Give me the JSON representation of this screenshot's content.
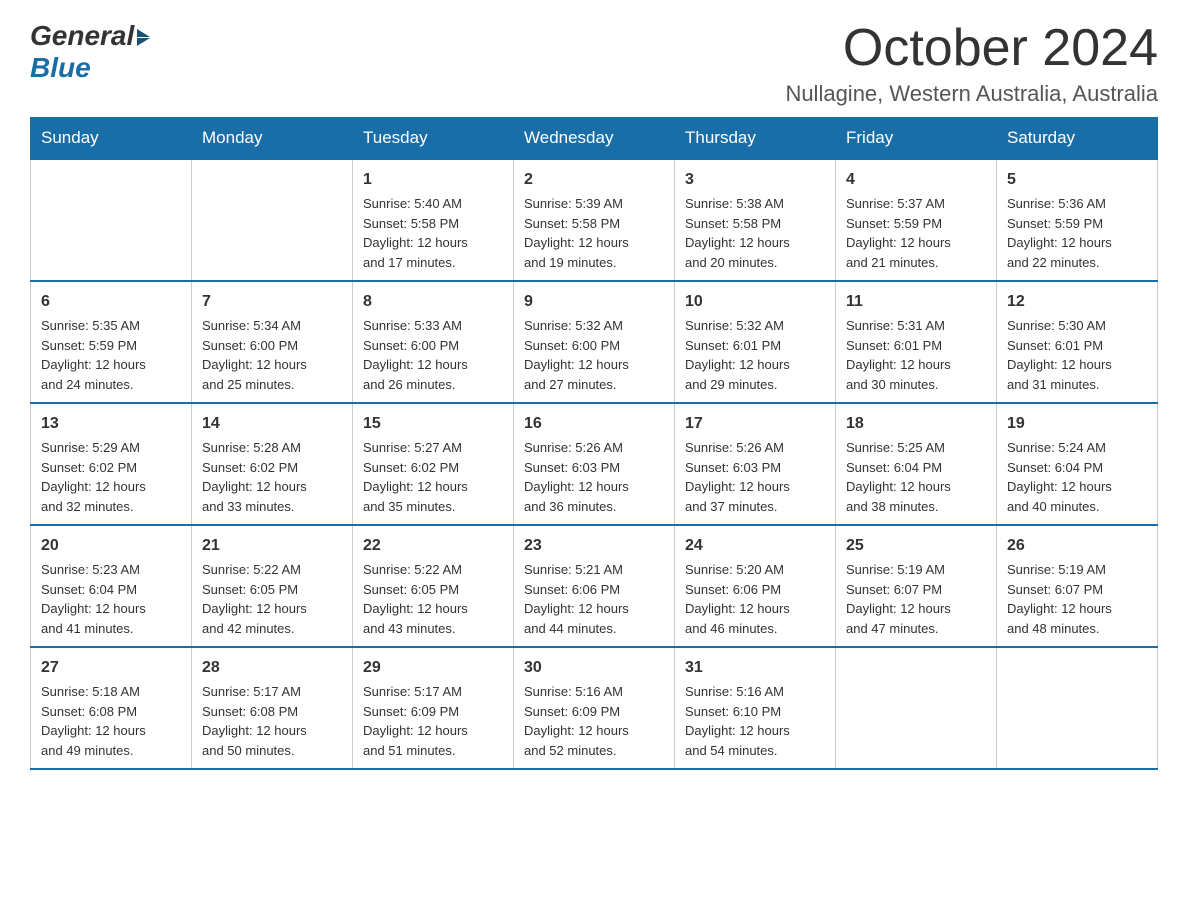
{
  "logo": {
    "general": "General",
    "blue": "Blue"
  },
  "title": "October 2024",
  "location": "Nullagine, Western Australia, Australia",
  "headers": [
    "Sunday",
    "Monday",
    "Tuesday",
    "Wednesday",
    "Thursday",
    "Friday",
    "Saturday"
  ],
  "weeks": [
    [
      {
        "day": "",
        "info": ""
      },
      {
        "day": "",
        "info": ""
      },
      {
        "day": "1",
        "info": "Sunrise: 5:40 AM\nSunset: 5:58 PM\nDaylight: 12 hours\nand 17 minutes."
      },
      {
        "day": "2",
        "info": "Sunrise: 5:39 AM\nSunset: 5:58 PM\nDaylight: 12 hours\nand 19 minutes."
      },
      {
        "day": "3",
        "info": "Sunrise: 5:38 AM\nSunset: 5:58 PM\nDaylight: 12 hours\nand 20 minutes."
      },
      {
        "day": "4",
        "info": "Sunrise: 5:37 AM\nSunset: 5:59 PM\nDaylight: 12 hours\nand 21 minutes."
      },
      {
        "day": "5",
        "info": "Sunrise: 5:36 AM\nSunset: 5:59 PM\nDaylight: 12 hours\nand 22 minutes."
      }
    ],
    [
      {
        "day": "6",
        "info": "Sunrise: 5:35 AM\nSunset: 5:59 PM\nDaylight: 12 hours\nand 24 minutes."
      },
      {
        "day": "7",
        "info": "Sunrise: 5:34 AM\nSunset: 6:00 PM\nDaylight: 12 hours\nand 25 minutes."
      },
      {
        "day": "8",
        "info": "Sunrise: 5:33 AM\nSunset: 6:00 PM\nDaylight: 12 hours\nand 26 minutes."
      },
      {
        "day": "9",
        "info": "Sunrise: 5:32 AM\nSunset: 6:00 PM\nDaylight: 12 hours\nand 27 minutes."
      },
      {
        "day": "10",
        "info": "Sunrise: 5:32 AM\nSunset: 6:01 PM\nDaylight: 12 hours\nand 29 minutes."
      },
      {
        "day": "11",
        "info": "Sunrise: 5:31 AM\nSunset: 6:01 PM\nDaylight: 12 hours\nand 30 minutes."
      },
      {
        "day": "12",
        "info": "Sunrise: 5:30 AM\nSunset: 6:01 PM\nDaylight: 12 hours\nand 31 minutes."
      }
    ],
    [
      {
        "day": "13",
        "info": "Sunrise: 5:29 AM\nSunset: 6:02 PM\nDaylight: 12 hours\nand 32 minutes."
      },
      {
        "day": "14",
        "info": "Sunrise: 5:28 AM\nSunset: 6:02 PM\nDaylight: 12 hours\nand 33 minutes."
      },
      {
        "day": "15",
        "info": "Sunrise: 5:27 AM\nSunset: 6:02 PM\nDaylight: 12 hours\nand 35 minutes."
      },
      {
        "day": "16",
        "info": "Sunrise: 5:26 AM\nSunset: 6:03 PM\nDaylight: 12 hours\nand 36 minutes."
      },
      {
        "day": "17",
        "info": "Sunrise: 5:26 AM\nSunset: 6:03 PM\nDaylight: 12 hours\nand 37 minutes."
      },
      {
        "day": "18",
        "info": "Sunrise: 5:25 AM\nSunset: 6:04 PM\nDaylight: 12 hours\nand 38 minutes."
      },
      {
        "day": "19",
        "info": "Sunrise: 5:24 AM\nSunset: 6:04 PM\nDaylight: 12 hours\nand 40 minutes."
      }
    ],
    [
      {
        "day": "20",
        "info": "Sunrise: 5:23 AM\nSunset: 6:04 PM\nDaylight: 12 hours\nand 41 minutes."
      },
      {
        "day": "21",
        "info": "Sunrise: 5:22 AM\nSunset: 6:05 PM\nDaylight: 12 hours\nand 42 minutes."
      },
      {
        "day": "22",
        "info": "Sunrise: 5:22 AM\nSunset: 6:05 PM\nDaylight: 12 hours\nand 43 minutes."
      },
      {
        "day": "23",
        "info": "Sunrise: 5:21 AM\nSunset: 6:06 PM\nDaylight: 12 hours\nand 44 minutes."
      },
      {
        "day": "24",
        "info": "Sunrise: 5:20 AM\nSunset: 6:06 PM\nDaylight: 12 hours\nand 46 minutes."
      },
      {
        "day": "25",
        "info": "Sunrise: 5:19 AM\nSunset: 6:07 PM\nDaylight: 12 hours\nand 47 minutes."
      },
      {
        "day": "26",
        "info": "Sunrise: 5:19 AM\nSunset: 6:07 PM\nDaylight: 12 hours\nand 48 minutes."
      }
    ],
    [
      {
        "day": "27",
        "info": "Sunrise: 5:18 AM\nSunset: 6:08 PM\nDaylight: 12 hours\nand 49 minutes."
      },
      {
        "day": "28",
        "info": "Sunrise: 5:17 AM\nSunset: 6:08 PM\nDaylight: 12 hours\nand 50 minutes."
      },
      {
        "day": "29",
        "info": "Sunrise: 5:17 AM\nSunset: 6:09 PM\nDaylight: 12 hours\nand 51 minutes."
      },
      {
        "day": "30",
        "info": "Sunrise: 5:16 AM\nSunset: 6:09 PM\nDaylight: 12 hours\nand 52 minutes."
      },
      {
        "day": "31",
        "info": "Sunrise: 5:16 AM\nSunset: 6:10 PM\nDaylight: 12 hours\nand 54 minutes."
      },
      {
        "day": "",
        "info": ""
      },
      {
        "day": "",
        "info": ""
      }
    ]
  ]
}
